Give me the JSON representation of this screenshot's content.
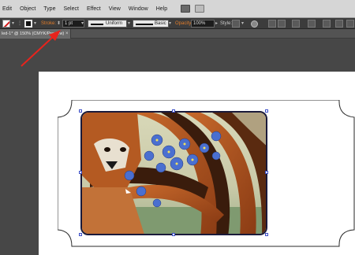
{
  "menubar": {
    "items": [
      "Edit",
      "Object",
      "Type",
      "Select",
      "Effect",
      "View",
      "Window",
      "Help"
    ]
  },
  "controlbar": {
    "stroke_label": "Stroke:",
    "stroke_weight": "1 pt",
    "profile_label": "Uniform",
    "brush_label": "Basic",
    "opacity_label": "Opacity:",
    "opacity_value": "100%",
    "style_label": "Style:"
  },
  "document_tab": {
    "title": "led-1* @ 150% (CMYK/Preview)",
    "close_glyph": "×"
  },
  "colors": {
    "accent_orange": "#e07c2a",
    "annotation_red": "#e8231c",
    "selection_blue": "#3d50c8"
  },
  "icons": {
    "arrow_annotation": "red-arrow-icon",
    "fill_swatch": "no-fill-swatch-icon",
    "stroke_swatch": "stroke-swatch-icon"
  }
}
